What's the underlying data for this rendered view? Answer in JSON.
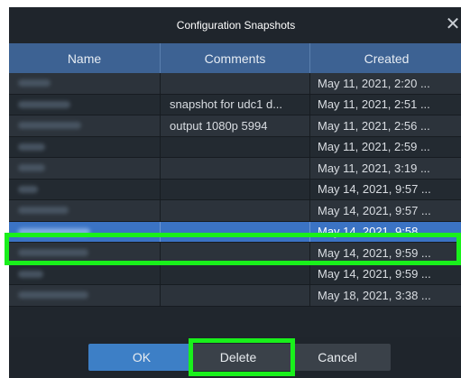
{
  "dialog": {
    "title": "Configuration Snapshots",
    "close_glyph": "✕"
  },
  "columns": [
    "Name",
    "Comments",
    "Created"
  ],
  "rows": [
    {
      "name": "snap1",
      "comment": "",
      "created": "May 11, 2021, 2:20 ..."
    },
    {
      "name": "udc1 snap",
      "comment": "snapshot for udc1 d...",
      "created": "May 11, 2021, 2:51 ..."
    },
    {
      "name": "udc1 snap2",
      "comment": "output 1080p 5994",
      "created": "May 11, 2021, 2:56 ..."
    },
    {
      "name": "snap3",
      "comment": "",
      "created": "May 11, 2021, 2:59 ..."
    },
    {
      "name": "snap4",
      "comment": "",
      "created": "May 11, 2021, 3:19 ..."
    },
    {
      "name": "ex4",
      "comment": "",
      "created": "May 14, 2021, 9:57 ..."
    },
    {
      "name": "SDC scrut",
      "comment": "",
      "created": "May 14, 2021, 9:57 ..."
    },
    {
      "name": "ssfordelay sports",
      "comment": "",
      "created": "May 14, 2021, 9:58 ...",
      "selected": true
    },
    {
      "name": "ssaddelay sports",
      "comment": "",
      "created": "May 14, 2021, 9:59 ..."
    },
    {
      "name": "US-B11",
      "comment": "",
      "created": "May 14, 2021, 9:59 ..."
    },
    {
      "name": "baseband 2019",
      "comment": "",
      "created": "May 18, 2021, 3:38 ..."
    }
  ],
  "buttons": {
    "ok": "OK",
    "delete": "Delete",
    "cancel": "Cancel"
  },
  "colors": {
    "highlight": "#19f01b",
    "header": "#3d6293",
    "selected_row": "#3b73c4"
  }
}
